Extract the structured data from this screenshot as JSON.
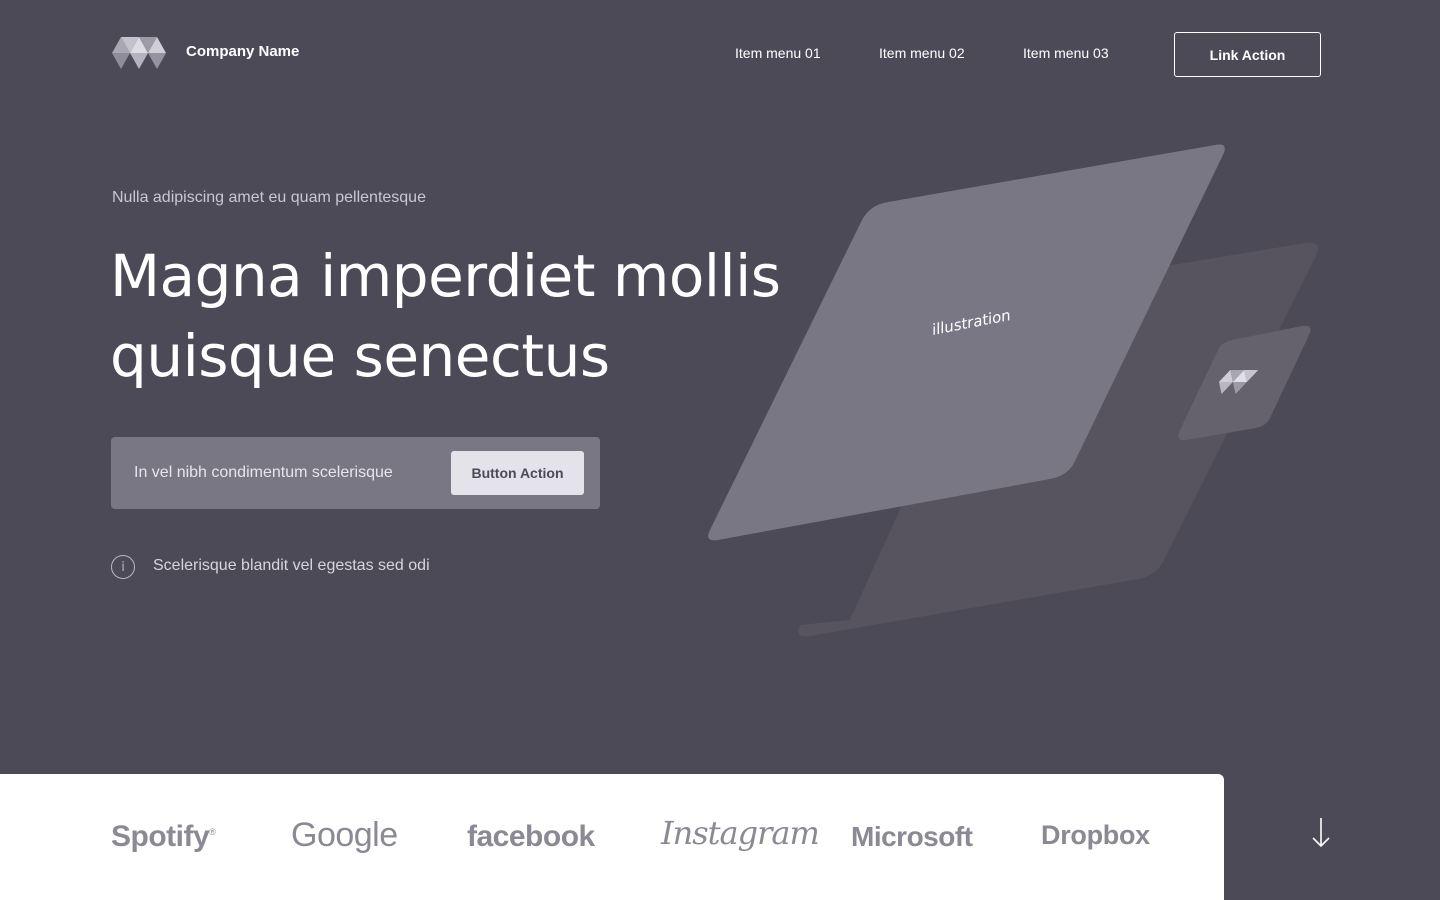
{
  "header": {
    "company_name": "Company Name",
    "nav": [
      {
        "label": "Item menu 01"
      },
      {
        "label": "Item menu 02"
      },
      {
        "label": "Item menu 03"
      }
    ],
    "cta_label": "Link Action"
  },
  "hero": {
    "eyebrow": "Nulla adipiscing amet eu quam pellentesque",
    "title_line1": "Magna imperdiet mollis",
    "title_line2": "quisque senectus",
    "form": {
      "input_placeholder": "In vel nibh condimentum scelerisque",
      "button_label": "Button Action"
    },
    "info_icon_glyph": "i",
    "info_text": "Scelerisque blandit vel egestas sed odi",
    "illustration_label": "illustration"
  },
  "brands": [
    {
      "name": "Spotify",
      "mark": "®"
    },
    {
      "name": "Google"
    },
    {
      "name": "facebook"
    },
    {
      "name": "Instagram"
    },
    {
      "name": "Microsoft"
    },
    {
      "name": "Dropbox"
    }
  ],
  "icons": {
    "logo": "logo-icon",
    "info": "info-icon",
    "scroll": "arrow-down-icon"
  },
  "colors": {
    "background": "#4d4a58",
    "panel": "#7a7784",
    "button_light": "#e4e3e9",
    "brand_gray": "#8b8994",
    "white": "#ffffff"
  }
}
